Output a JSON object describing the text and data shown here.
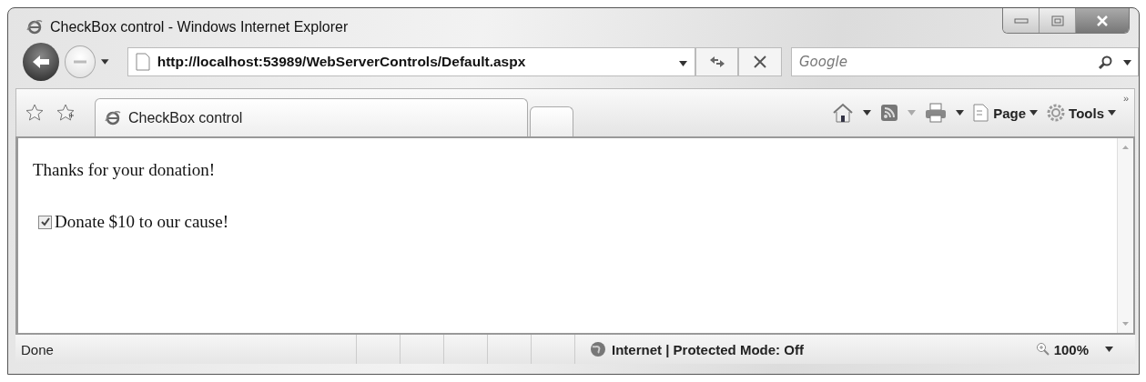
{
  "window": {
    "title": "CheckBox control - Windows Internet Explorer"
  },
  "address_bar": {
    "value": "http://localhost:53989/WebServerControls/Default.aspx"
  },
  "search": {
    "placeholder": "Google"
  },
  "tabs": [
    {
      "label": "CheckBox control",
      "selected": true
    }
  ],
  "command_bar": [
    {
      "label": "Page"
    },
    {
      "label": "Tools"
    }
  ],
  "command_bar_overflow": "»",
  "content": {
    "message": "Thanks for your donation!",
    "checkbox": {
      "label": "Donate $10 to our cause!",
      "checked": true
    }
  },
  "status_bar": {
    "status": "Done",
    "zone": "Internet | Protected Mode: Off",
    "zoom": "100%"
  }
}
